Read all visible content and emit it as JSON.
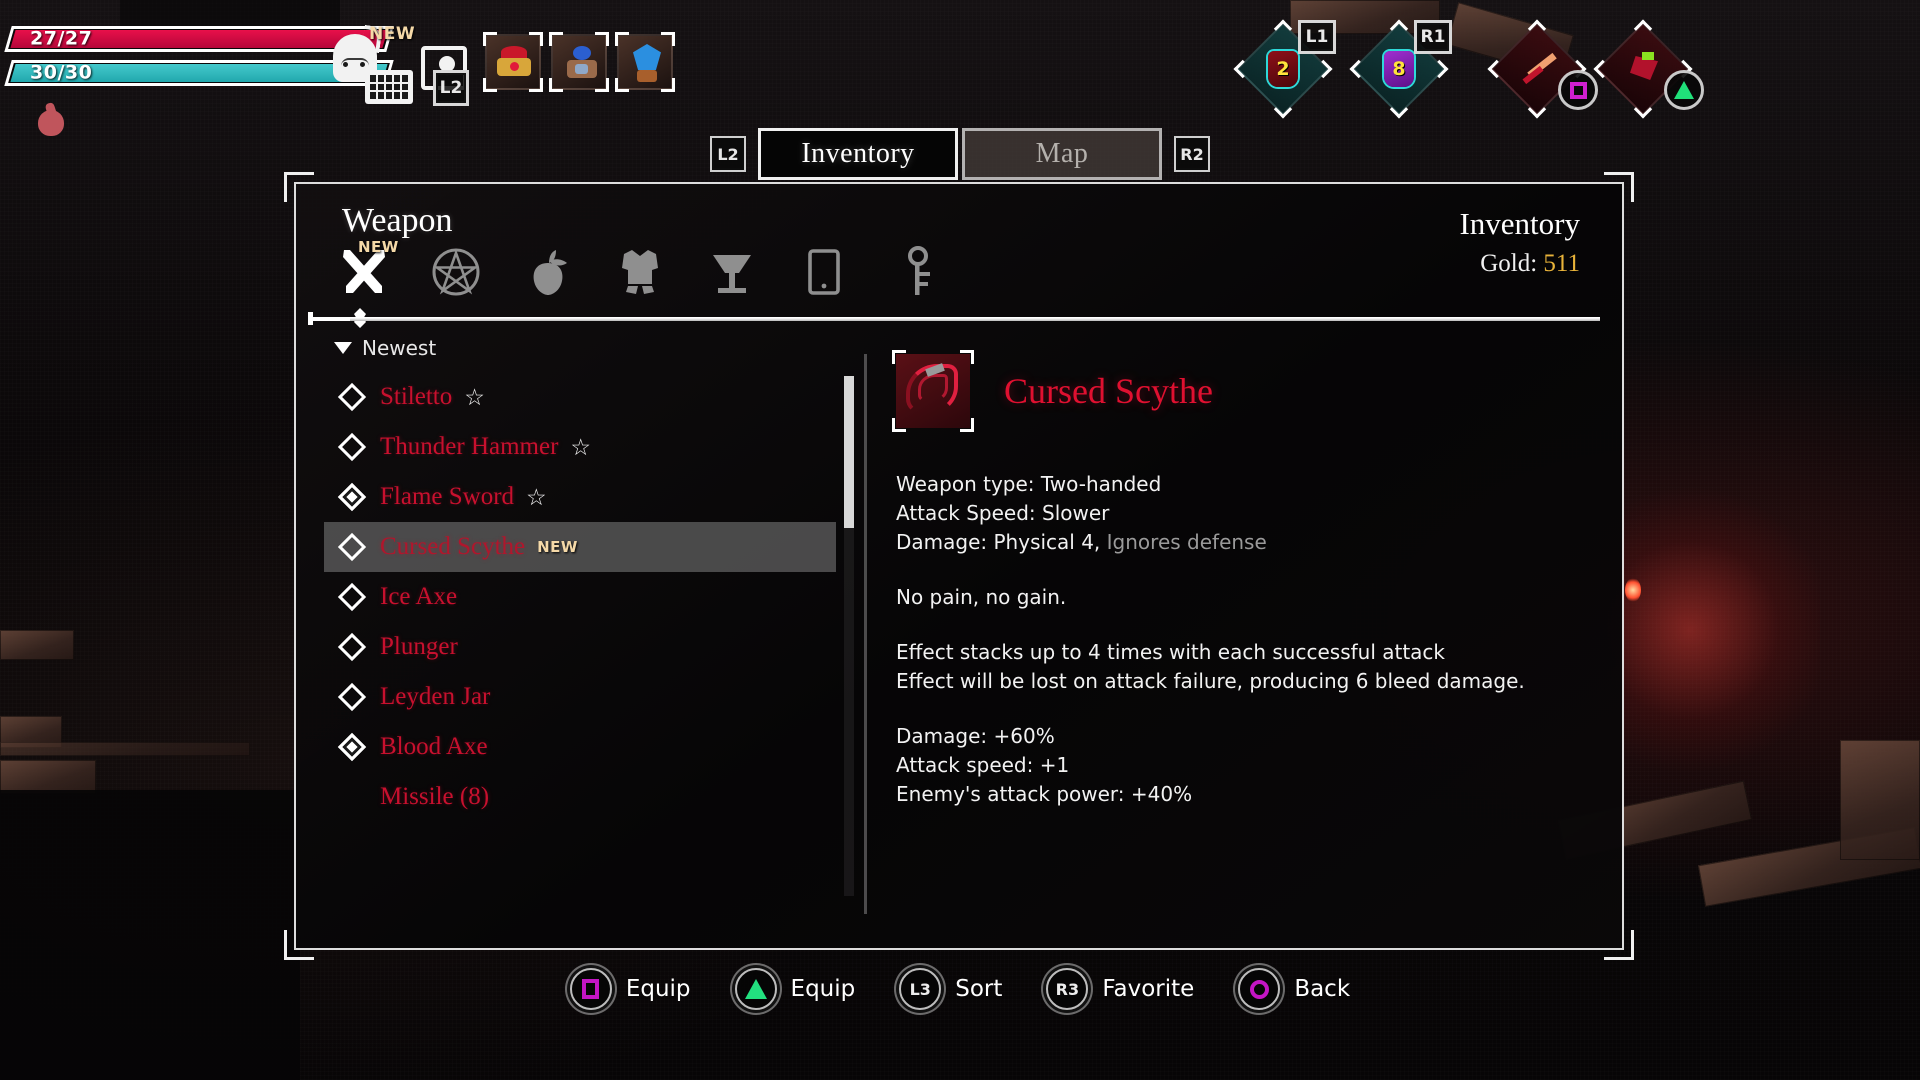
{
  "hud": {
    "health": {
      "label": "27/27",
      "current": 27,
      "max": 27,
      "color": "#e8104a"
    },
    "stamina": {
      "label": "30/30",
      "current": 30,
      "max": 30,
      "color": "#44c9cc"
    },
    "backpack_badge": "NEW",
    "map_key": "L2",
    "shoulder_left": {
      "key": "L1",
      "count": "2"
    },
    "shoulder_right": {
      "key": "R1",
      "count": "8"
    }
  },
  "tabs": {
    "left_key": "L2",
    "right_key": "R2",
    "items": [
      {
        "label": "Inventory",
        "active": true
      },
      {
        "label": "Map",
        "active": false
      }
    ]
  },
  "window": {
    "title": "Weapon",
    "header_right_title": "Inventory",
    "gold_label": "Gold:",
    "gold_value": "511",
    "gold_color": "#e8b33a"
  },
  "categories": [
    {
      "name": "weapon",
      "icon": "crossed-swords-icon",
      "active": true,
      "badge": "NEW"
    },
    {
      "name": "magic",
      "icon": "pentagram-icon",
      "active": false,
      "badge": ""
    },
    {
      "name": "food",
      "icon": "fruit-icon",
      "active": false,
      "badge": ""
    },
    {
      "name": "armor",
      "icon": "armor-icon",
      "active": false,
      "badge": ""
    },
    {
      "name": "drink",
      "icon": "goblet-icon",
      "active": false,
      "badge": ""
    },
    {
      "name": "device",
      "icon": "tablet-icon",
      "active": false,
      "badge": ""
    },
    {
      "name": "key",
      "icon": "key-icon",
      "active": false,
      "badge": ""
    }
  ],
  "sort": {
    "caret": "down-caret-icon",
    "label": "Newest"
  },
  "items": [
    {
      "name": "Stiletto",
      "favorite": true,
      "equipped": false,
      "badge": "",
      "selected": false
    },
    {
      "name": "Thunder Hammer",
      "favorite": true,
      "equipped": false,
      "badge": "",
      "selected": false
    },
    {
      "name": "Flame Sword",
      "favorite": true,
      "equipped": true,
      "badge": "",
      "selected": false
    },
    {
      "name": "Cursed Scythe",
      "favorite": false,
      "equipped": false,
      "badge": "NEW",
      "selected": true
    },
    {
      "name": "Ice Axe",
      "favorite": false,
      "equipped": false,
      "badge": "",
      "selected": false
    },
    {
      "name": "Plunger",
      "favorite": false,
      "equipped": false,
      "badge": "",
      "selected": false
    },
    {
      "name": "Leyden Jar",
      "favorite": false,
      "equipped": false,
      "badge": "",
      "selected": false
    },
    {
      "name": "Blood Axe",
      "favorite": false,
      "equipped": true,
      "badge": "",
      "selected": false
    },
    {
      "name": "Missile (8)",
      "favorite": false,
      "equipped": false,
      "badge": "",
      "selected": false
    }
  ],
  "detail": {
    "title": "Cursed Scythe",
    "title_color": "#e01030",
    "icon": "cursed-scythe-icon",
    "stats": {
      "weapon_type": "Weapon type: Two-handed",
      "attack_speed": "Attack Speed: Slower",
      "damage_prefix": "Damage: Physical 4, ",
      "damage_suffix": "Ignores defense"
    },
    "flavor": "No pain, no gain.",
    "effects": [
      "Effect stacks up to 4 times with each successful attack",
      "Effect will be lost on attack failure, producing 6 bleed damage."
    ],
    "modifiers": [
      "Damage: +60%",
      "Attack speed: +1",
      "Enemy's attack power: +40%"
    ]
  },
  "prompts": [
    {
      "button": "square-button-icon",
      "glyph": "sq",
      "text": "",
      "label": "Equip"
    },
    {
      "button": "triangle-button-icon",
      "glyph": "tri",
      "text": "",
      "label": "Equip"
    },
    {
      "button": "l3-button-icon",
      "glyph": "txt",
      "text": "L3",
      "label": "Sort"
    },
    {
      "button": "r3-button-icon",
      "glyph": "txt",
      "text": "R3",
      "label": "Favorite"
    },
    {
      "button": "circle-button-icon",
      "glyph": "cir",
      "text": "",
      "label": "Back"
    }
  ]
}
